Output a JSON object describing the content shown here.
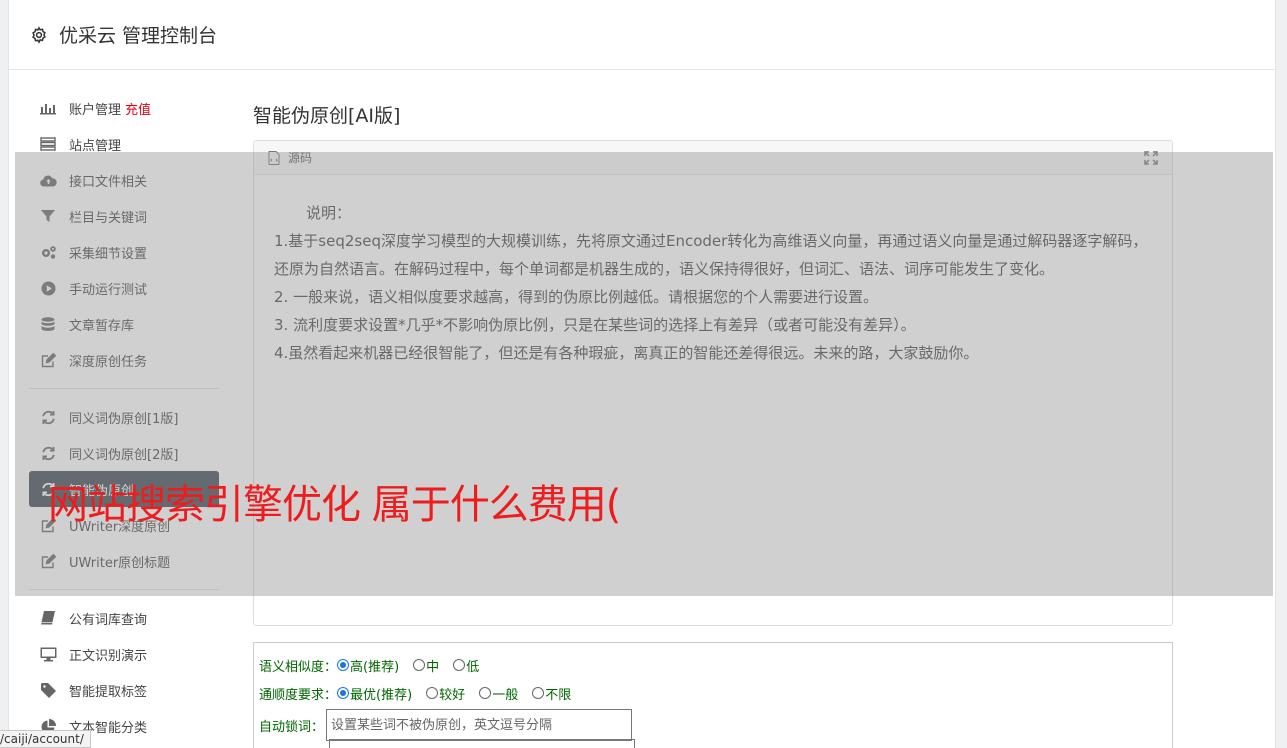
{
  "header": {
    "title": "优采云 管理控制台"
  },
  "sidebar": {
    "groups": [
      [
        {
          "name": "sidebar-item-account",
          "icon": "bar-chart-icon",
          "label": "账户管理",
          "badge": "充值"
        },
        {
          "name": "sidebar-item-sites",
          "icon": "server-icon",
          "label": "站点管理"
        },
        {
          "name": "sidebar-item-api-files",
          "icon": "cloud-upload-icon",
          "label": "接口文件相关"
        },
        {
          "name": "sidebar-item-columns-keywords",
          "icon": "filter-icon",
          "label": "栏目与关键词"
        },
        {
          "name": "sidebar-item-collect-settings",
          "icon": "cogs-icon",
          "label": "采集细节设置"
        },
        {
          "name": "sidebar-item-manual-run",
          "icon": "play-circle-icon",
          "label": "手动运行测试"
        },
        {
          "name": "sidebar-item-article-store",
          "icon": "database-icon",
          "label": "文章暂存库"
        },
        {
          "name": "sidebar-item-deep-original",
          "icon": "edit-icon",
          "label": "深度原创任务"
        }
      ],
      [
        {
          "name": "sidebar-item-synonym-v1",
          "icon": "refresh-icon",
          "label": "同义词伪原创[1版]"
        },
        {
          "name": "sidebar-item-synonym-v2",
          "icon": "refresh-icon",
          "label": "同义词伪原创[2版]"
        },
        {
          "name": "sidebar-item-ai-pseudo",
          "icon": "refresh-icon",
          "label": "智能伪原创",
          "active": true
        },
        {
          "name": "sidebar-item-uwriter-deep",
          "icon": "edit-icon",
          "label": "UWriter深度原创"
        },
        {
          "name": "sidebar-item-uwriter-title",
          "icon": "edit-icon",
          "label": "UWriter原创标题"
        }
      ],
      [
        {
          "name": "sidebar-item-public-lexicon",
          "icon": "book-icon",
          "label": "公有词库查询"
        },
        {
          "name": "sidebar-item-text-recognition",
          "icon": "monitor-icon",
          "label": "正文识别演示"
        },
        {
          "name": "sidebar-item-smart-tags",
          "icon": "tag-icon",
          "label": "智能提取标签"
        },
        {
          "name": "sidebar-item-text-classify",
          "icon": "pie-chart-icon",
          "label": "文本智能分类"
        }
      ]
    ]
  },
  "main": {
    "page_title": "智能伪原创[AI版]",
    "source_panel": {
      "label": "源码",
      "note_title": "说明：",
      "lines": [
        "1.基于seq2seq深度学习模型的大规模训练，先将原文通过Encoder转化为高维语义向量，再通过语义向量是通过解码器逐字解码，还原为自然语言。在解码过程中，每个单词都是机器生成的，语义保持得很好，但词汇、语法、词序可能发生了变化。",
        "2. 一般来说，语义相似度要求越高，得到的伪原比例越低。请根据您的个人需要进行设置。",
        "3. 流利度要求设置*几乎*不影响伪原比例，只是在某些词的选择上有差异（或者可能没有差异）。",
        "4.虽然看起来机器已经很智能了，但还是有各种瑕疵，离真正的智能还差得很远。未来的路，大家鼓励你。"
      ]
    },
    "form": {
      "similarity": {
        "label": "语义相似度：",
        "options": [
          {
            "label": "高(推荐)",
            "checked": true
          },
          {
            "label": "中",
            "checked": false
          },
          {
            "label": "低",
            "checked": false
          }
        ]
      },
      "fluency": {
        "label": "通顺度要求：",
        "options": [
          {
            "label": "最优(推荐)",
            "checked": true
          },
          {
            "label": "较好",
            "checked": false
          },
          {
            "label": "一般",
            "checked": false
          },
          {
            "label": "不限",
            "checked": false
          }
        ]
      },
      "lock_words": {
        "label": "自动锁词：",
        "placeholder": "设置某些词不被伪原创，英文逗号分隔"
      }
    }
  },
  "overlay": {
    "watermark": "网站搜索引擎优化 属于什么费用("
  },
  "statusbar": {
    "url": "/caiji/account/"
  },
  "colors": {
    "accent": "#1a73e8",
    "badge": "#e4000f",
    "active_nav": "#3c4650",
    "form_label": "#006600",
    "watermark": "#ee1c1c"
  }
}
